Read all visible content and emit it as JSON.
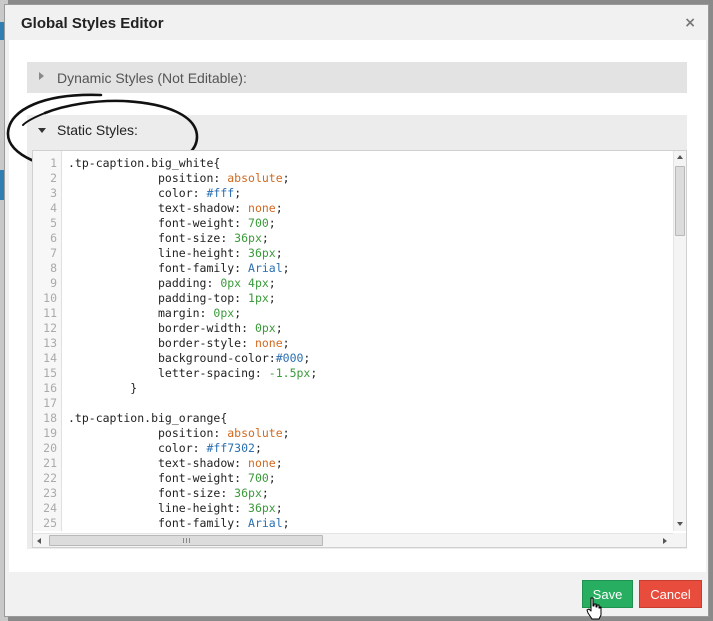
{
  "dialog": {
    "title": "Global Styles Editor",
    "close_glyph": "×",
    "close_icon": "close-icon"
  },
  "sections": {
    "dynamic_label": "Dynamic Styles (Not Editable):",
    "static_label": "Static Styles:"
  },
  "editor": {
    "lines": [
      {
        "n": "1",
        "segs": [
          {
            "t": ".tp-caption.big_white{",
            "c": "k"
          }
        ]
      },
      {
        "n": "2",
        "segs": [
          {
            "t": "             position: ",
            "c": "k"
          },
          {
            "t": "absolute",
            "c": "v-orange"
          },
          {
            "t": ";",
            "c": "k"
          }
        ]
      },
      {
        "n": "3",
        "segs": [
          {
            "t": "             color: ",
            "c": "k"
          },
          {
            "t": "#fff",
            "c": "v-blue"
          },
          {
            "t": ";",
            "c": "k"
          }
        ]
      },
      {
        "n": "4",
        "segs": [
          {
            "t": "             text-shadow: ",
            "c": "k"
          },
          {
            "t": "none",
            "c": "v-orange"
          },
          {
            "t": ";",
            "c": "k"
          }
        ]
      },
      {
        "n": "5",
        "segs": [
          {
            "t": "             font-weight: ",
            "c": "k"
          },
          {
            "t": "700",
            "c": "v-green"
          },
          {
            "t": ";",
            "c": "k"
          }
        ]
      },
      {
        "n": "6",
        "segs": [
          {
            "t": "             font-size: ",
            "c": "k"
          },
          {
            "t": "36px",
            "c": "v-green"
          },
          {
            "t": ";",
            "c": "k"
          }
        ]
      },
      {
        "n": "7",
        "segs": [
          {
            "t": "             line-height: ",
            "c": "k"
          },
          {
            "t": "36px",
            "c": "v-green"
          },
          {
            "t": ";",
            "c": "k"
          }
        ]
      },
      {
        "n": "8",
        "segs": [
          {
            "t": "             font-family: ",
            "c": "k"
          },
          {
            "t": "Arial",
            "c": "v-blue"
          },
          {
            "t": ";",
            "c": "k"
          }
        ]
      },
      {
        "n": "9",
        "segs": [
          {
            "t": "             padding: ",
            "c": "k"
          },
          {
            "t": "0px 4px",
            "c": "v-green"
          },
          {
            "t": ";",
            "c": "k"
          }
        ]
      },
      {
        "n": "10",
        "segs": [
          {
            "t": "             padding-top: ",
            "c": "k"
          },
          {
            "t": "1px",
            "c": "v-green"
          },
          {
            "t": ";",
            "c": "k"
          }
        ]
      },
      {
        "n": "11",
        "segs": [
          {
            "t": "             margin: ",
            "c": "k"
          },
          {
            "t": "0px",
            "c": "v-green"
          },
          {
            "t": ";",
            "c": "k"
          }
        ]
      },
      {
        "n": "12",
        "segs": [
          {
            "t": "             border-width: ",
            "c": "k"
          },
          {
            "t": "0px",
            "c": "v-green"
          },
          {
            "t": ";",
            "c": "k"
          }
        ]
      },
      {
        "n": "13",
        "segs": [
          {
            "t": "             border-style: ",
            "c": "k"
          },
          {
            "t": "none",
            "c": "v-orange"
          },
          {
            "t": ";",
            "c": "k"
          }
        ]
      },
      {
        "n": "14",
        "segs": [
          {
            "t": "             background-color:",
            "c": "k"
          },
          {
            "t": "#000",
            "c": "v-blue"
          },
          {
            "t": ";",
            "c": "k"
          }
        ]
      },
      {
        "n": "15",
        "segs": [
          {
            "t": "             letter-spacing: ",
            "c": "k"
          },
          {
            "t": "-1.5px",
            "c": "v-green"
          },
          {
            "t": ";",
            "c": "k"
          }
        ]
      },
      {
        "n": "16",
        "segs": [
          {
            "t": "         }",
            "c": "k"
          }
        ]
      },
      {
        "n": "17",
        "segs": [
          {
            "t": "",
            "c": "k"
          }
        ]
      },
      {
        "n": "18",
        "segs": [
          {
            "t": ".tp-caption.big_orange{",
            "c": "k"
          }
        ]
      },
      {
        "n": "19",
        "segs": [
          {
            "t": "             position: ",
            "c": "k"
          },
          {
            "t": "absolute",
            "c": "v-orange"
          },
          {
            "t": ";",
            "c": "k"
          }
        ]
      },
      {
        "n": "20",
        "segs": [
          {
            "t": "             color: ",
            "c": "k"
          },
          {
            "t": "#ff7302",
            "c": "v-blue"
          },
          {
            "t": ";",
            "c": "k"
          }
        ]
      },
      {
        "n": "21",
        "segs": [
          {
            "t": "             text-shadow: ",
            "c": "k"
          },
          {
            "t": "none",
            "c": "v-orange"
          },
          {
            "t": ";",
            "c": "k"
          }
        ]
      },
      {
        "n": "22",
        "segs": [
          {
            "t": "             font-weight: ",
            "c": "k"
          },
          {
            "t": "700",
            "c": "v-green"
          },
          {
            "t": ";",
            "c": "k"
          }
        ]
      },
      {
        "n": "23",
        "segs": [
          {
            "t": "             font-size: ",
            "c": "k"
          },
          {
            "t": "36px",
            "c": "v-green"
          },
          {
            "t": ";",
            "c": "k"
          }
        ]
      },
      {
        "n": "24",
        "segs": [
          {
            "t": "             line-height: ",
            "c": "k"
          },
          {
            "t": "36px",
            "c": "v-green"
          },
          {
            "t": ";",
            "c": "k"
          }
        ]
      },
      {
        "n": "25",
        "segs": [
          {
            "t": "             font-family: ",
            "c": "k"
          },
          {
            "t": "Arial",
            "c": "v-blue"
          },
          {
            "t": ";",
            "c": "k"
          }
        ]
      }
    ],
    "scrollbar_grip": "III"
  },
  "buttons": {
    "save_label": "Save",
    "cancel_label": "Cancel"
  },
  "colors": {
    "save": "#27ae60",
    "cancel": "#e74c3c",
    "orange_value": "#d2691e",
    "green_value": "#3a9a3a",
    "blue_value": "#2a6fb0"
  }
}
